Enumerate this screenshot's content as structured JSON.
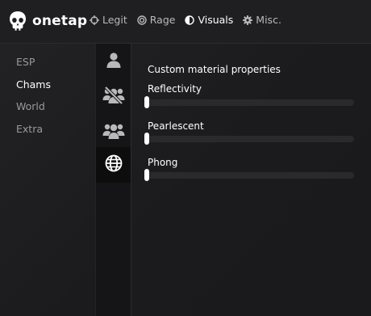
{
  "header": {
    "logo_text": "onetap",
    "nav": [
      {
        "label": "Legit",
        "icon": "crosshair-icon"
      },
      {
        "label": "Rage",
        "icon": "target-icon"
      },
      {
        "label": "Visuals",
        "icon": "half-circle-icon",
        "active": true
      },
      {
        "label": "Misc.",
        "icon": "gear-icon"
      }
    ]
  },
  "sidebar": {
    "items": [
      {
        "label": "ESP"
      },
      {
        "label": "Chams",
        "active": true
      },
      {
        "label": "World"
      },
      {
        "label": "Extra"
      }
    ]
  },
  "icon_tabs": [
    {
      "icon": "user-icon"
    },
    {
      "icon": "users-hidden-icon"
    },
    {
      "icon": "users-group-icon"
    },
    {
      "icon": "globe-icon",
      "active": true
    }
  ],
  "content": {
    "section_title": "Custom material properties",
    "sliders": [
      {
        "label": "Reflectivity",
        "value": 0
      },
      {
        "label": "Pearlescent",
        "value": 0
      },
      {
        "label": "Phong",
        "value": 0
      }
    ]
  }
}
